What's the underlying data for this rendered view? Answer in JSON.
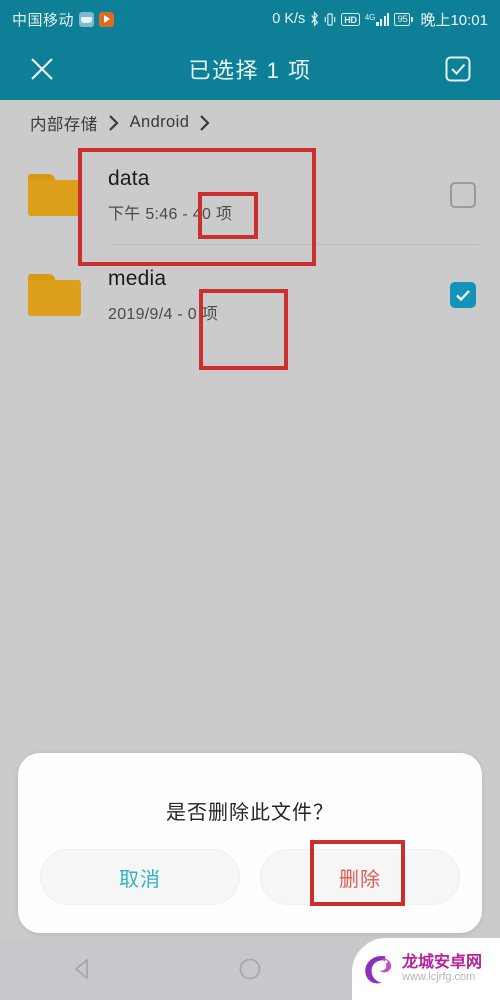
{
  "status_bar": {
    "carrier": "中国移动",
    "app_icons": [
      "mail-icon",
      "play-store-icon"
    ],
    "network_speed": "0 K/s",
    "bluetooth_icon": "bluetooth-icon",
    "vibrate_icon": "vibrate-icon",
    "hd_badge": "HD",
    "network_type": "4G",
    "battery_level": "95",
    "time": "晚上10:01"
  },
  "app_bar": {
    "close_icon": "close-icon",
    "title": "已选择 1 项",
    "select_all_icon": "select-all-checkbox-icon"
  },
  "breadcrumb": {
    "items": [
      "内部存储",
      "Android"
    ],
    "separator_icon": "chevron-right-icon"
  },
  "file_list": {
    "rows": [
      {
        "name": "data",
        "meta": "下午 5:46 - 40 项",
        "icon": "folder-icon",
        "checked": false
      },
      {
        "name": "media",
        "meta": "2019/9/4 - 0 项",
        "icon": "folder-icon",
        "checked": true
      }
    ]
  },
  "dialog": {
    "message": "是否删除此文件？",
    "cancel_label": "取消",
    "confirm_label": "删除"
  },
  "nav_bar": {
    "back_icon": "back-triangle-icon",
    "home_icon": "home-circle-icon",
    "recents_icon": "recents-square-icon"
  },
  "watermark": {
    "title": "龙城安卓网",
    "url": "www.lcjrfg.com",
    "logo_icon": "dragon-logo-icon"
  },
  "colors": {
    "teal": "#0d8098",
    "background": "#cbcbcb",
    "folder": "#dda01b",
    "checkbox_on": "#1493b8",
    "annotation_red": "#cc2f2f",
    "cancel_text": "#30b3c6",
    "delete_text": "#e25b52",
    "watermark_purple": "#b5219b"
  }
}
